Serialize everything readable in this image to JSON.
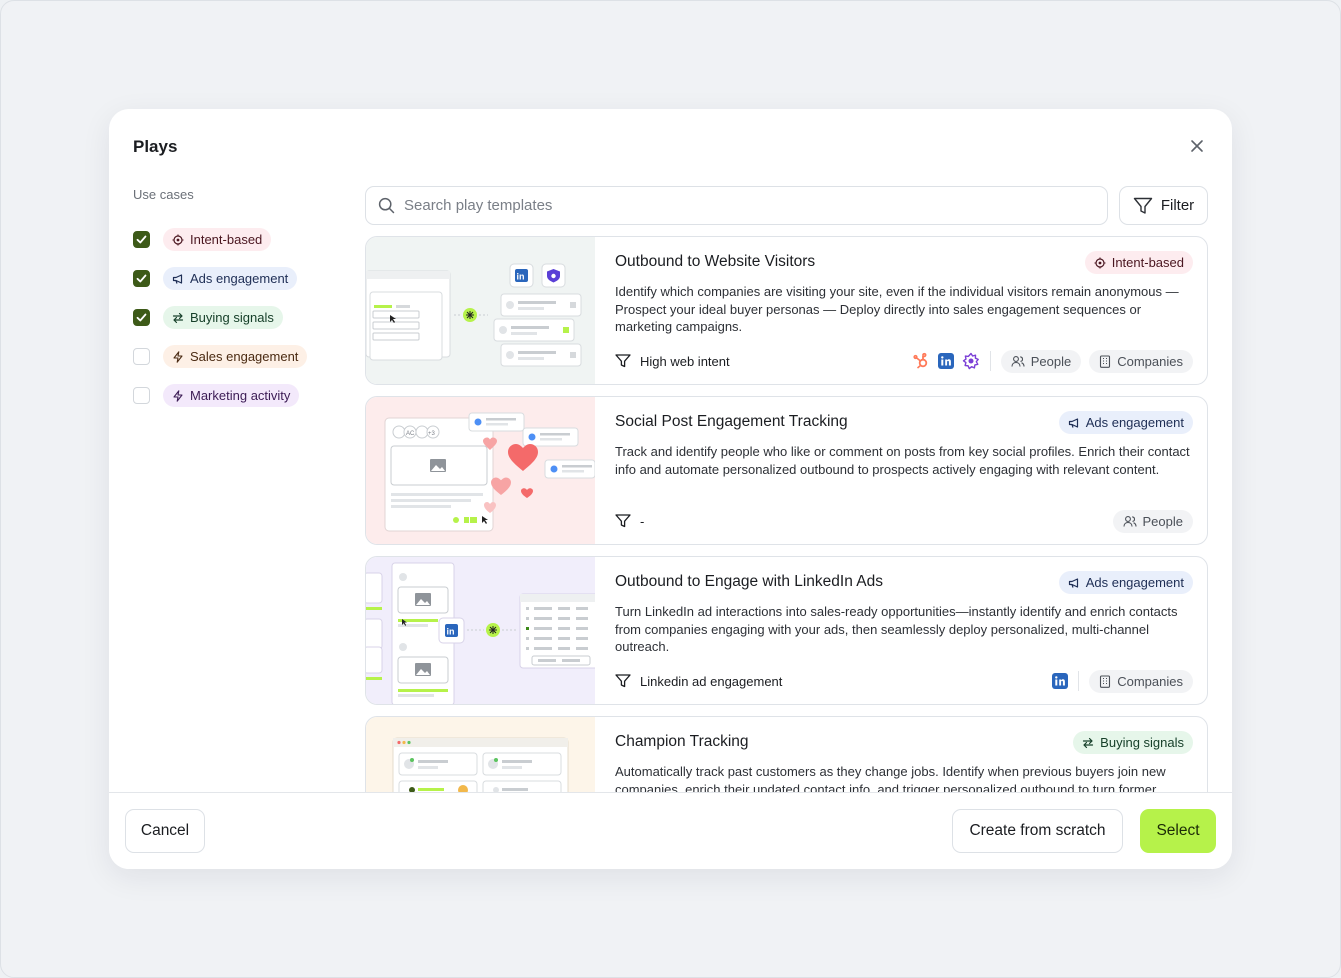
{
  "modal": {
    "title": "Plays"
  },
  "sidebar": {
    "heading": "Use cases",
    "items": [
      {
        "label": "Intent-based",
        "checked": true,
        "icon": "target-icon",
        "color": "#fdecef"
      },
      {
        "label": "Ads engagement",
        "checked": true,
        "icon": "megaphone-icon",
        "color": "#e9effb"
      },
      {
        "label": "Buying signals",
        "checked": true,
        "icon": "swap-arrows-icon",
        "color": "#e6f6ea"
      },
      {
        "label": "Sales engagement",
        "checked": false,
        "icon": "lightning-icon",
        "color": "#fdf0e6"
      },
      {
        "label": "Marketing activity",
        "checked": false,
        "icon": "lightning-icon",
        "color": "#f3e9fb"
      }
    ]
  },
  "search": {
    "placeholder": "Search play templates",
    "value": ""
  },
  "filter": {
    "label": "Filter"
  },
  "cards": [
    {
      "title": "Outbound to Website Visitors",
      "tag": "Intent-based",
      "description": "Identify which companies are visiting your site, even if the individual visitors remain anonymous — Prospect your ideal buyer personas — Deploy directly into sales engagement sequences or marketing campaigns.",
      "trigger": "High web intent",
      "integrations": [
        "hubspot-icon",
        "linkedin-icon",
        "outreach-icon"
      ],
      "chips": [
        "People",
        "Companies"
      ]
    },
    {
      "title": "Social Post Engagement Tracking",
      "tag": "Ads engagement",
      "description": "Track and identify people who like or comment on posts from key social profiles. Enrich their contact info and automate personalized outbound to prospects actively engaging with relevant content.",
      "trigger": "-",
      "integrations": [],
      "chips": [
        "People"
      ]
    },
    {
      "title": "Outbound to Engage with LinkedIn Ads",
      "tag": "Ads engagement",
      "description": "Turn LinkedIn ad interactions into sales-ready opportunities—instantly identify and enrich contacts from companies engaging with your ads, then seamlessly deploy personalized, multi-channel outreach.",
      "trigger": "Linkedin ad engagement",
      "integrations": [
        "linkedin-icon"
      ],
      "chips": [
        "Companies"
      ]
    },
    {
      "title": "Champion Tracking",
      "tag": "Buying signals",
      "description": "Automatically track past customers as they change jobs. Identify when previous buyers join new companies, enrich their updated contact info, and trigger personalized outbound to turn former",
      "trigger": "",
      "integrations": [],
      "chips": []
    }
  ],
  "footer": {
    "cancel": "Cancel",
    "create": "Create from scratch",
    "select": "Select"
  },
  "colors": {
    "accent": "#b6f24a",
    "checkbox": "#3d5a18",
    "linkedin": "#2a66bc",
    "hubspot": "#ff7a59"
  }
}
